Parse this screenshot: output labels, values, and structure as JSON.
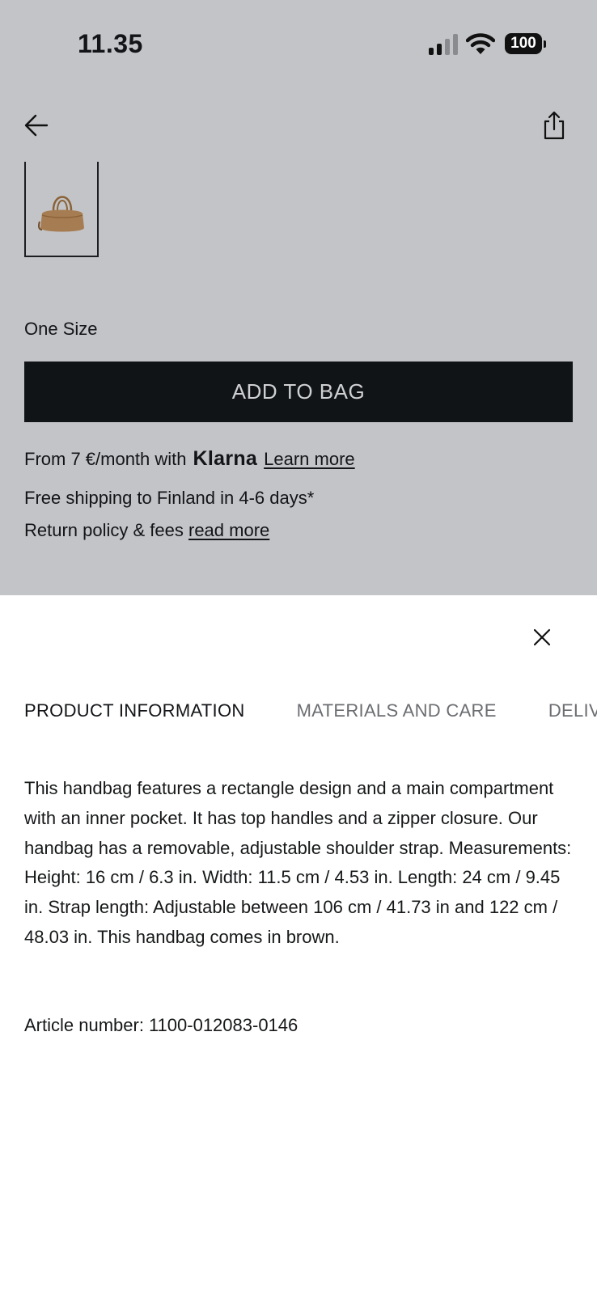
{
  "status_bar": {
    "time": "11.35",
    "battery": "100",
    "icons": [
      "signal-icon",
      "wifi-icon",
      "battery-icon"
    ]
  },
  "toolbar": {
    "back_icon": "arrow-left-icon",
    "share_icon": "share-icon"
  },
  "product": {
    "size_label": "One Size",
    "add_to_bag": "ADD TO BAG",
    "klarna": {
      "prefix": "From 7 €/month with",
      "brand": "Klarna",
      "link": "Learn more"
    },
    "shipping": "Free shipping to Finland in 4-6 days*",
    "returns": {
      "text": "Return policy & fees",
      "link": "read more"
    }
  },
  "sheet": {
    "close_icon": "close-icon",
    "tabs": [
      {
        "label": "PRODUCT INFORMATION",
        "active": true
      },
      {
        "label": "MATERIALS AND CARE",
        "active": false
      },
      {
        "label": "DELIVERY",
        "active": false
      }
    ],
    "description": "This handbag features a rectangle design and a main compartment with an inner pocket. It has top handles and a zipper closure. Our handbag has a removable, adjustable shoulder strap. Measurements: Height: 16 cm / 6.3 in. Width: 11.5 cm / 4.53 in. Length: 24 cm / 9.45 in. Strap length: Adjustable between 106 cm / 41.73 in and  122 cm / 48.03 in. This handbag comes in brown.",
    "article_label": "Article number:",
    "article_number": "1100-012083-0146"
  },
  "colors": {
    "overlay": "#c3c4c7",
    "button": "#111417",
    "bag": "#a67c52"
  }
}
